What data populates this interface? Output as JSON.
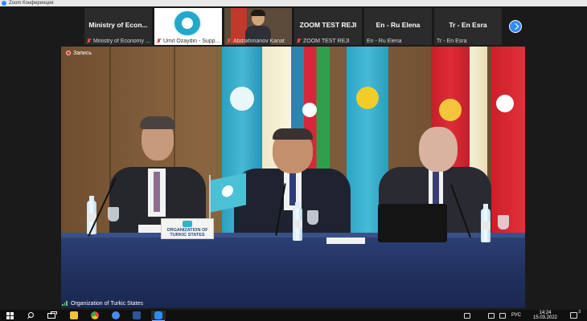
{
  "window": {
    "title": "Zoom Конференция",
    "accent_color": "#2d8cff"
  },
  "participants": [
    {
      "display": "Ministry of Econ...",
      "label": "Ministry of Economy ...",
      "muted": true,
      "type": "name"
    },
    {
      "display": "",
      "label": "Umit Ozaydin - Supp...",
      "muted": true,
      "type": "image"
    },
    {
      "display": "",
      "label": "Abdrahmanov Kanat",
      "muted": true,
      "type": "camera"
    },
    {
      "display": "ZOOM TEST REJI",
      "label": "ZOOM TEST REJI",
      "muted": true,
      "type": "name"
    },
    {
      "display": "En - Ru Elena",
      "label": "En - Ru Elena",
      "muted": false,
      "type": "name"
    },
    {
      "display": "Tr - En Esra",
      "label": "Tr - En Esra",
      "muted": false,
      "type": "name"
    }
  ],
  "strip_next": {
    "icon": "chevron-right-icon"
  },
  "recording": {
    "label": "Запись",
    "icon": "record-icon",
    "color": "#e03e3e"
  },
  "active_speaker": {
    "name": "Organization of Turkic States",
    "icon": "audio-level-icon"
  },
  "stage": {
    "nameplate_text": "ORGANIZATION OF TURKIC STATES"
  },
  "taskbar": {
    "items": [
      {
        "icon": "windows-start-icon"
      },
      {
        "icon": "search-icon"
      },
      {
        "icon": "task-view-icon"
      },
      {
        "icon": "file-explorer-icon",
        "color": "#f0c040"
      },
      {
        "icon": "chrome-icon",
        "color": "#e9473c"
      },
      {
        "icon": "chrome-alt-icon",
        "color": "#4a8af4"
      },
      {
        "icon": "word-icon",
        "color": "#2b579a"
      },
      {
        "icon": "zoom-icon",
        "color": "#2d8cff",
        "active": true
      }
    ],
    "tray": {
      "language": "РУС",
      "time": "14:24",
      "date": "15.03.2022",
      "notification_count": "3"
    }
  }
}
